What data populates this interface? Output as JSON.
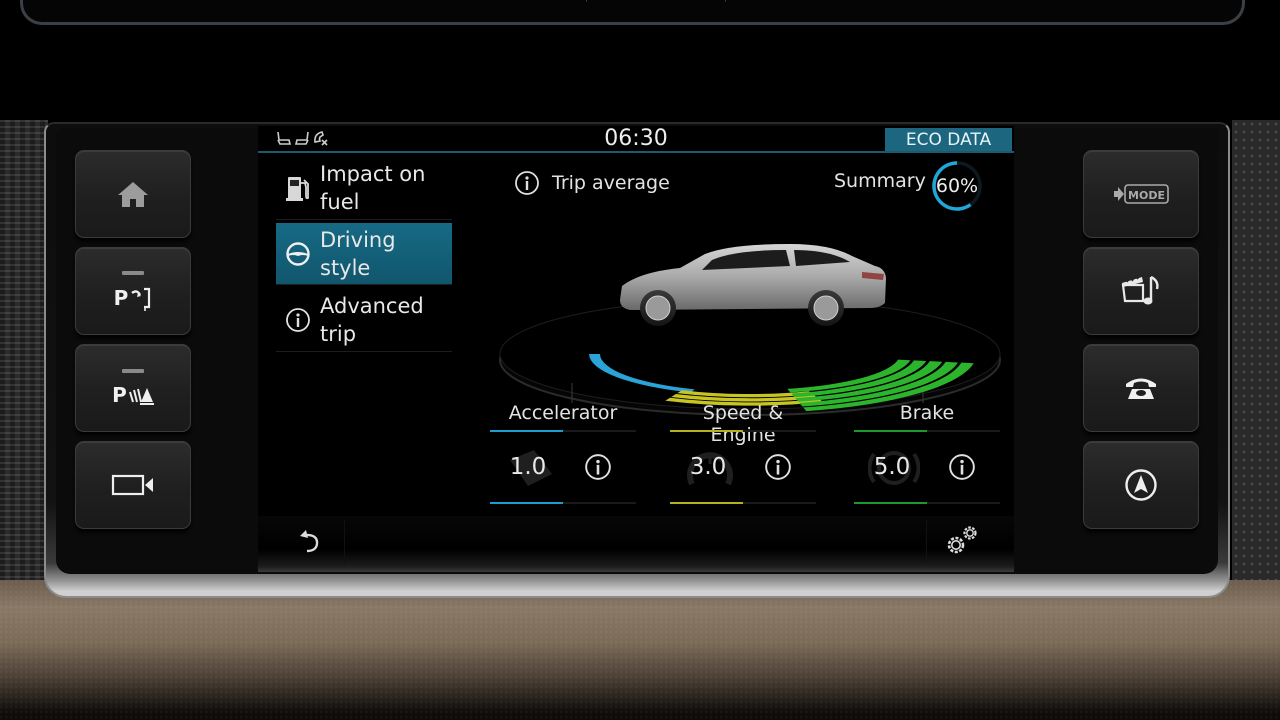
{
  "status_bar": {
    "time": "06:30",
    "section_badge": "ECO DATA",
    "icons": [
      "seat-heating-icon",
      "seat-cooling-icon",
      "phone-missed-icon"
    ]
  },
  "menu": {
    "items": [
      {
        "label": "Impact on fuel",
        "icon": "fuel-pump-icon",
        "active": false
      },
      {
        "label": "Driving style",
        "icon": "steering-wheel-icon",
        "active": true
      },
      {
        "label": "Advanced trip",
        "icon": "info-icon",
        "active": false
      }
    ]
  },
  "content": {
    "trip_average_label": "Trip average",
    "summary_label": "Summary",
    "summary_value": "60%",
    "summary_percent": 60
  },
  "metrics": [
    {
      "name": "Accelerator",
      "value": "1.0",
      "score": 1.0,
      "max": 5,
      "bar_fraction": 0.5,
      "color": "#1e9bd0",
      "icon": "accelerator-pedal-icon"
    },
    {
      "name": "Speed & Engine",
      "value": "3.0",
      "score": 3.0,
      "max": 5,
      "bar_fraction": 0.5,
      "color": "#b4b21c",
      "icon": "speedometer-icon"
    },
    {
      "name": "Brake",
      "value": "5.0",
      "score": 5.0,
      "max": 5,
      "bar_fraction": 0.5,
      "color": "#1c9a2e",
      "icon": "brake-disc-icon"
    }
  ],
  "graphic": {
    "accelerator_color": "#2aa4d8",
    "speed_color": "#c8c423",
    "brake_color": "#2cb52c",
    "accelerator_bands": 1,
    "speed_bands": 3,
    "brake_bands": 5
  },
  "hard_buttons": {
    "left": [
      {
        "name": "home",
        "icon": "home-icon"
      },
      {
        "name": "park-assist",
        "icon": "park-assist-icon",
        "label": "P"
      },
      {
        "name": "parking-sensors",
        "icon": "parking-sensor-icon",
        "label": "P"
      },
      {
        "name": "camera",
        "icon": "camera-icon"
      }
    ],
    "right": [
      {
        "name": "mode",
        "icon": "mode-icon",
        "label": "MODE"
      },
      {
        "name": "media",
        "icon": "media-icon"
      },
      {
        "name": "phone",
        "icon": "phone-icon"
      },
      {
        "name": "navigation",
        "icon": "navigation-icon"
      }
    ]
  },
  "colors": {
    "accent": "#1c6680",
    "active_menu": "#166a85"
  }
}
